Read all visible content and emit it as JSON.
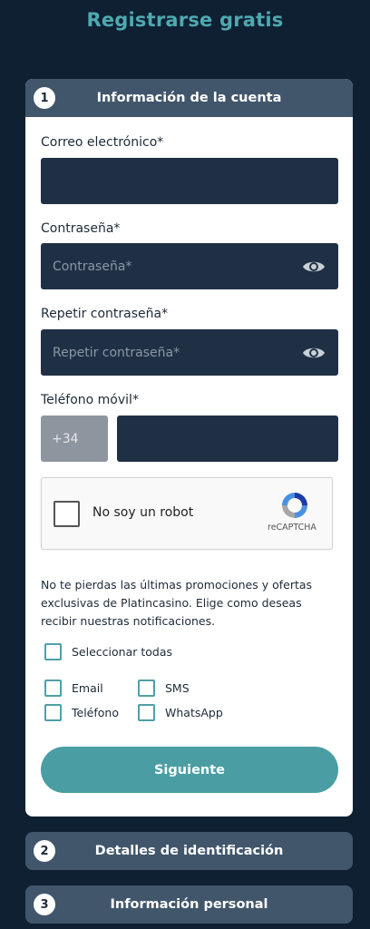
{
  "page": {
    "title": "Registrarse gratis"
  },
  "steps": [
    {
      "number": "1",
      "title": "Información de la cuenta"
    },
    {
      "number": "2",
      "title": "Detalles de identificación"
    },
    {
      "number": "3",
      "title": "Información personal"
    }
  ],
  "form": {
    "email_label": "Correo electrónico*",
    "email_value": "",
    "password_label": "Contraseña*",
    "password_placeholder": "Contraseña*",
    "repeat_password_label": "Repetir contraseña*",
    "repeat_password_placeholder": "Repetir contraseña*",
    "phone_label": "Teléfono móvil*",
    "phone_prefix": "+34",
    "phone_value": ""
  },
  "captcha": {
    "label": "No soy un robot",
    "brand": "reCAPTCHA"
  },
  "promotions": {
    "text": "No te pierdas las últimas promociones y ofertas exclusivas de Platincasino. Elige como deseas recibir nuestras notificaciones.",
    "select_all_label": "Seleccionar todas",
    "options": [
      {
        "label": "Email",
        "checked": false
      },
      {
        "label": "SMS",
        "checked": false
      },
      {
        "label": "Teléfono",
        "checked": false
      },
      {
        "label": "WhatsApp",
        "checked": false
      }
    ]
  },
  "actions": {
    "next_label": "Siguiente"
  },
  "colors": {
    "background": "#0f2033",
    "accent": "#4a9ea3",
    "title": "#4fa9b0",
    "step_header": "#41566b",
    "input": "#1f3045"
  }
}
